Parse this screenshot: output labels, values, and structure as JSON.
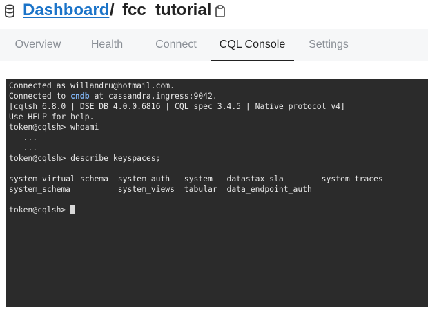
{
  "breadcrumb": {
    "parent": "Dashboard",
    "separator": "/",
    "current": "fcc_tutorial"
  },
  "icons": {
    "database": "database-icon",
    "copy": "clipboard-icon"
  },
  "tabs": [
    {
      "label": "Overview",
      "active": false
    },
    {
      "label": "Health",
      "active": false
    },
    {
      "label": "Connect",
      "active": false
    },
    {
      "label": "CQL Console",
      "active": true
    },
    {
      "label": "Settings",
      "active": false
    }
  ],
  "colors": {
    "link": "#1a73c8",
    "terminal_bg": "#2b2b2b",
    "terminal_text": "#e6e6e6",
    "highlight": "#7fb2f0"
  },
  "terminal": {
    "line1": "Connected as willandru@hotmail.com.",
    "line2_prefix": "Connected to ",
    "line2_cluster": "cndb",
    "line2_suffix": " at cassandra.ingress:9042.",
    "line3": "[cqlsh 6.8.0 | DSE DB 4.0.0.6816 | CQL spec 3.4.5 | Native protocol v4]",
    "line4": "Use HELP for help.",
    "line5": "token@cqlsh> whoami",
    "line6": "   ...",
    "line7": "   ...",
    "line8": "token@cqlsh> describe keyspaces;",
    "line9": "",
    "line10": "system_virtual_schema  system_auth   system   datastax_sla        system_traces",
    "line11": "system_schema          system_views  tabular  data_endpoint_auth",
    "line12": "",
    "prompt": "token@cqlsh>"
  }
}
